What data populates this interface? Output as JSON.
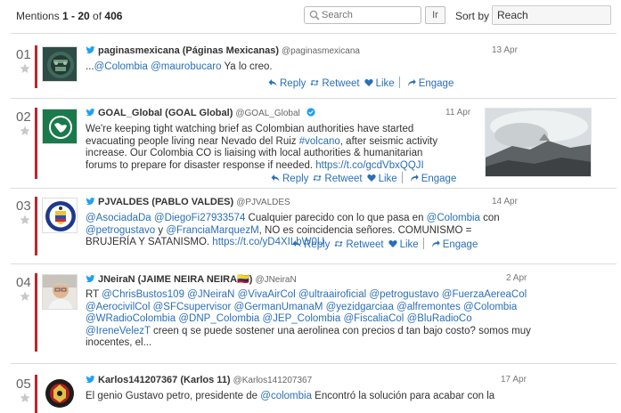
{
  "toolbar": {
    "mentions_prefix": "Mentions ",
    "range": "1 - 20",
    "of_label": " of ",
    "total": "406",
    "search_placeholder": "Search",
    "lang_button": "Ir",
    "sort_label": "Sort by",
    "sort_value": "Reach"
  },
  "actions": {
    "reply": "Reply",
    "retweet": "Retweet",
    "like": "Like",
    "engage": "Engage"
  },
  "colors": {
    "accent_bar": "#c0242d",
    "link": "#2a6fb8"
  },
  "mentions": [
    {
      "num": "01",
      "author": "paginasmexicana (Páginas Mexicanas)",
      "handle": "@paginasmexicana",
      "date": "13 Apr",
      "segments": [
        {
          "t": "..."
        },
        {
          "t": "@Colombia",
          "link": true
        },
        {
          "t": " "
        },
        {
          "t": "@maurobucaro",
          "link": true
        },
        {
          "t": " Ya lo creo."
        }
      ]
    },
    {
      "num": "02",
      "author": "GOAL_Global (GOAL Global)",
      "handle": "@GOAL_Global",
      "verified": true,
      "date": "11 Apr",
      "segments": [
        {
          "t": "We're keeping tight watching brief as Colombian authorities have started evacuating people living near Nevado del Ruiz "
        },
        {
          "t": "#volcano",
          "link": true
        },
        {
          "t": ", after seismic activity increase. Our Colombia CO is liaising with local authorities & humanitarian forums to prepare for disaster response if needed. "
        },
        {
          "t": "https://t.co/gcdVbxQQJI",
          "link": true
        }
      ]
    },
    {
      "num": "03",
      "author": "PJVALDES (PABLO VALDES)",
      "handle": "@PJVALDES",
      "date": "14 Apr",
      "segments": [
        {
          "t": "@AsociadaDa",
          "link": true
        },
        {
          "t": " "
        },
        {
          "t": "@DiegoFi27933574",
          "link": true
        },
        {
          "t": " Cualquier parecido con lo que pasa en "
        },
        {
          "t": "@Colombia",
          "link": true
        },
        {
          "t": " con "
        },
        {
          "t": "@petrogustavo",
          "link": true
        },
        {
          "t": " y "
        },
        {
          "t": "@FranciaMarquezM",
          "link": true
        },
        {
          "t": ", NO es coincidencia señores. COMUNISMO = BRUJERÍA Y SATANISMO. "
        },
        {
          "t": "https://t.co/yD4XILbW0U",
          "link": true
        }
      ]
    },
    {
      "num": "04",
      "author": "JNeiraN (JAIME NEIRA NEIRA🇨🇴)",
      "handle": "@JNeiraN",
      "date": "2 Apr",
      "segments": [
        {
          "t": "RT "
        },
        {
          "t": "@ChrisBustos109",
          "link": true
        },
        {
          "t": " "
        },
        {
          "t": "@JNeiraN",
          "link": true
        },
        {
          "t": " "
        },
        {
          "t": "@VivaAirCol",
          "link": true
        },
        {
          "t": " "
        },
        {
          "t": "@ultraairoficial",
          "link": true
        },
        {
          "t": " "
        },
        {
          "t": "@petrogustavo",
          "link": true
        },
        {
          "t": " "
        },
        {
          "t": "@FuerzaAereaCol",
          "link": true
        },
        {
          "t": " "
        },
        {
          "t": "@AerocivilCol",
          "link": true
        },
        {
          "t": " "
        },
        {
          "t": "@SFCsupervisor",
          "link": true
        },
        {
          "t": " "
        },
        {
          "t": "@GermanUmanaM",
          "link": true
        },
        {
          "t": " "
        },
        {
          "t": "@yezidgarciaa",
          "link": true
        },
        {
          "t": " "
        },
        {
          "t": "@alfremontes",
          "link": true
        },
        {
          "t": " "
        },
        {
          "t": "@Colombia",
          "link": true
        },
        {
          "t": " "
        },
        {
          "t": "@WRadioColombia",
          "link": true
        },
        {
          "t": " "
        },
        {
          "t": "@DNP_Colombia",
          "link": true
        },
        {
          "t": " "
        },
        {
          "t": "@JEP_Colombia",
          "link": true
        },
        {
          "t": " "
        },
        {
          "t": "@FiscaliaCol",
          "link": true
        },
        {
          "t": " "
        },
        {
          "t": "@BluRadioCo",
          "link": true
        },
        {
          "t": " "
        },
        {
          "t": "@IreneVelezT",
          "link": true
        },
        {
          "t": " creen q se puede sostener una aerolinea con precios d tan bajo costo? somos muy inocentes, el..."
        }
      ]
    },
    {
      "num": "05",
      "author": "Karlos141207367 (Karlos 11)",
      "handle": "@Karlos141207367",
      "date": "17 Apr",
      "segments": [
        {
          "t": "El genio Gustavo petro, presidente de "
        },
        {
          "t": "@colombia",
          "link": true
        },
        {
          "t": " Encontró la solución para acabar con la"
        }
      ]
    }
  ]
}
